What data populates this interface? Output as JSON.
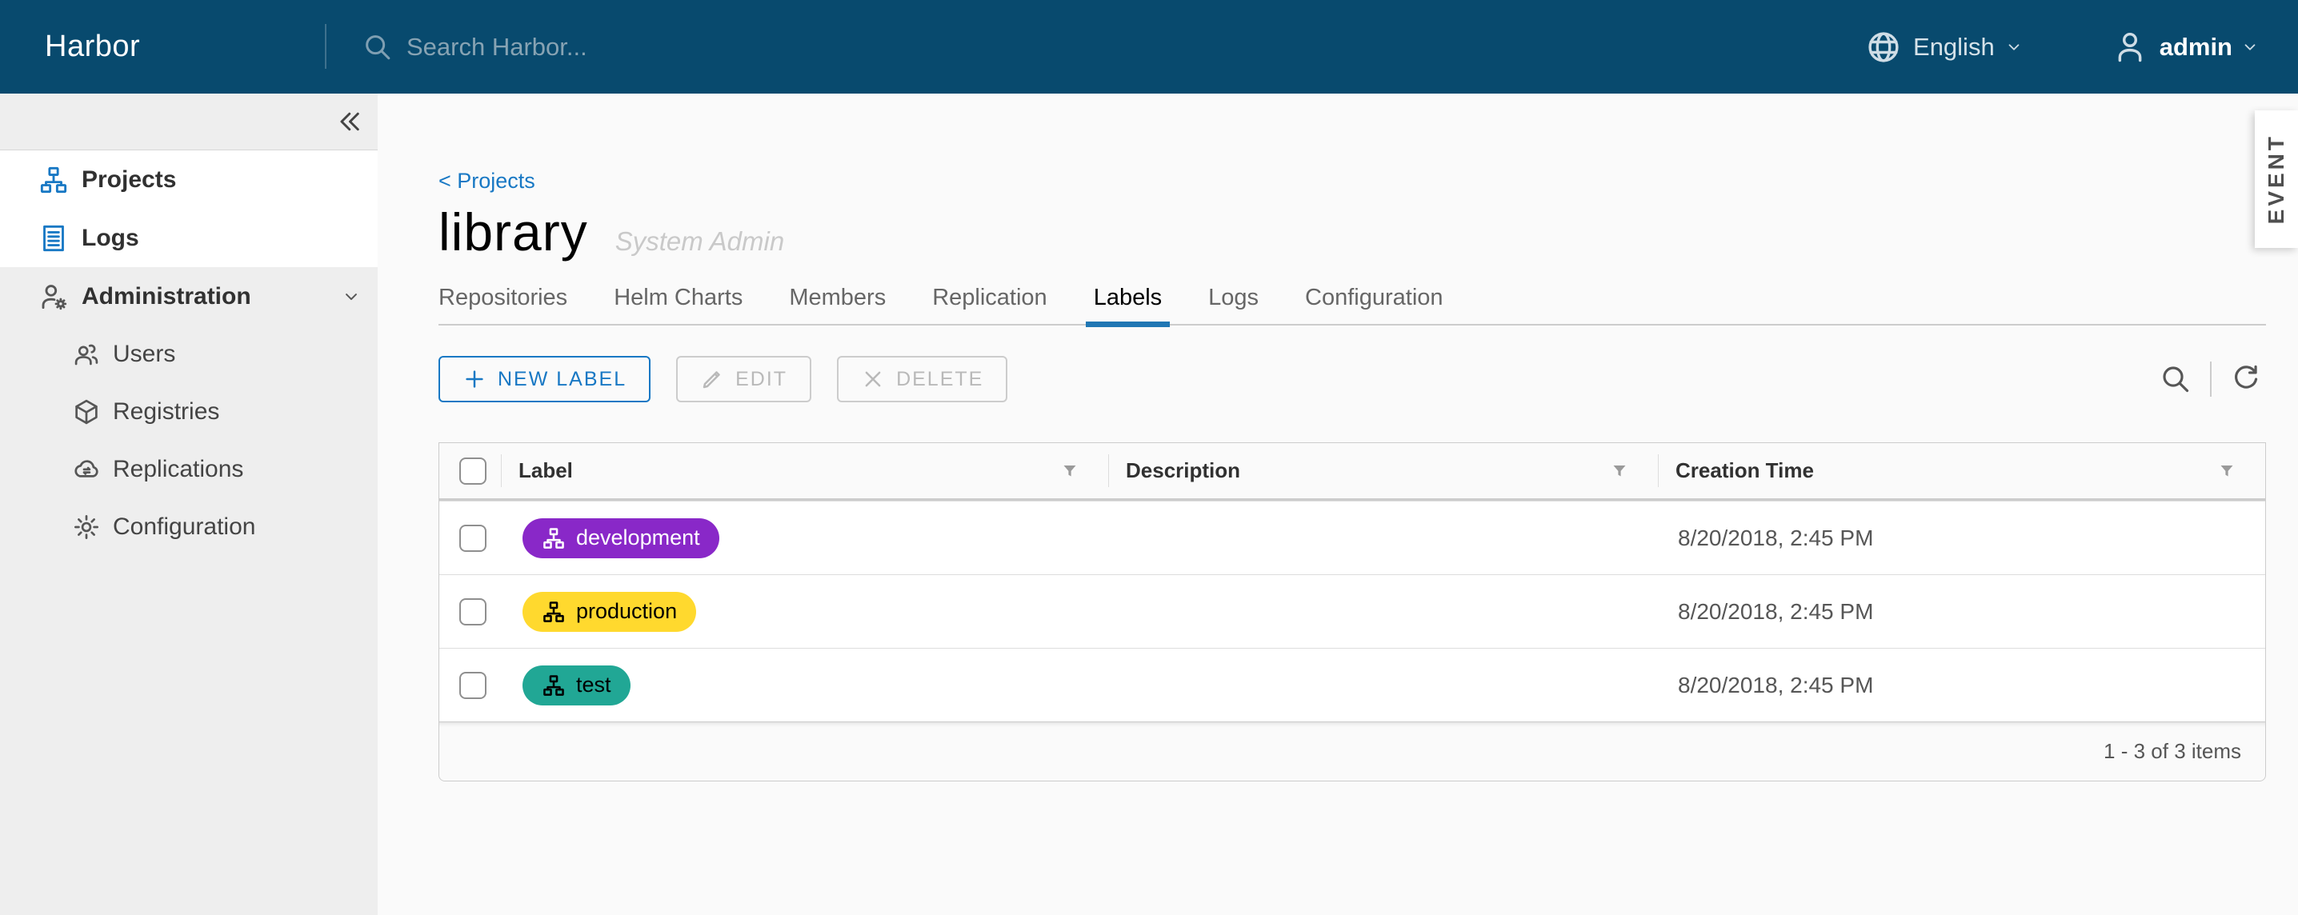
{
  "colors": {
    "navbar_bg": "#084a6e",
    "accent_blue": "#1878c4",
    "active_tab_underline": "#2077b4",
    "label_development": "#8928c8",
    "label_production": "#ffd92e",
    "label_test": "#21a795"
  },
  "navbar": {
    "brand": "Harbor",
    "search_placeholder": "Search Harbor...",
    "language": "English",
    "username": "admin"
  },
  "sidebar": {
    "items": [
      "Projects",
      "Logs",
      "Administration"
    ],
    "administration_children": [
      "Users",
      "Registries",
      "Replications",
      "Configuration"
    ]
  },
  "page": {
    "breadcrumb": "< Projects",
    "title": "library",
    "subtitle": "System Admin"
  },
  "tabs": {
    "items": [
      "Repositories",
      "Helm Charts",
      "Members",
      "Replication",
      "Labels",
      "Logs",
      "Configuration"
    ],
    "active": "Labels"
  },
  "toolbar": {
    "new_label": "NEW LABEL",
    "edit": "EDIT",
    "delete": "DELETE"
  },
  "table": {
    "columns": [
      "Label",
      "Description",
      "Creation Time"
    ],
    "rows": [
      {
        "label": "development",
        "color": "#8928c8",
        "text_color": "#ffffff",
        "description": "",
        "creation_time": "8/20/2018, 2:45 PM"
      },
      {
        "label": "production",
        "color": "#ffd92e",
        "text_color": "#000000",
        "description": "",
        "creation_time": "8/20/2018, 2:45 PM"
      },
      {
        "label": "test",
        "color": "#21a795",
        "text_color": "#000000",
        "description": "",
        "creation_time": "8/20/2018, 2:45 PM"
      }
    ],
    "footer": "1 - 3 of 3 items"
  },
  "event_tab": "EVENT"
}
